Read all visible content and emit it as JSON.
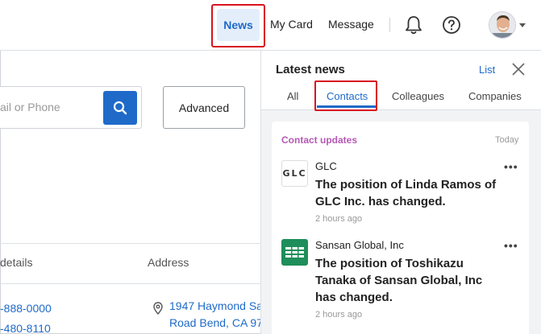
{
  "topnav": {
    "news": "News",
    "mycard": "My Card",
    "message": "Message"
  },
  "search": {
    "placeholder_partial": "ail or Phone",
    "advanced_label": "Advanced"
  },
  "table": {
    "col_details": " details",
    "col_address": "Address",
    "phone1": "-888-0000",
    "phone2": "-480-8110",
    "address_line1": "1947 Haymond Sa",
    "address_line2": "Road Bend, CA 97"
  },
  "panel": {
    "title": "Latest news",
    "list_link": "List",
    "tabs": [
      {
        "label": "All",
        "active": false
      },
      {
        "label": "Contacts",
        "active": true
      },
      {
        "label": "Colleagues",
        "active": false
      },
      {
        "label": "Companies",
        "active": false
      }
    ],
    "section_title": "Contact updates",
    "section_date": "Today",
    "items": [
      {
        "logo_text": "GLC",
        "company": "GLC",
        "headline": "The position of Linda Ramos of GLC Inc. has changed.",
        "time": "2 hours ago",
        "more": "•••"
      },
      {
        "logo_text": "",
        "company": "Sansan Global, Inc",
        "headline": "The position of Toshikazu Tanaka of Sansan Global, Inc has changed.",
        "time": "2 hours ago",
        "more": "•••"
      }
    ]
  },
  "colors": {
    "accent": "#1f6ac9",
    "highlight": "#d9131f",
    "section_title": "#b45ab4",
    "sansan_green": "#1e8e5a"
  },
  "icons": [
    "bell-icon",
    "help-icon",
    "avatar",
    "chevron-down-icon",
    "search-icon",
    "close-icon",
    "location-pin-icon",
    "more-icon"
  ]
}
